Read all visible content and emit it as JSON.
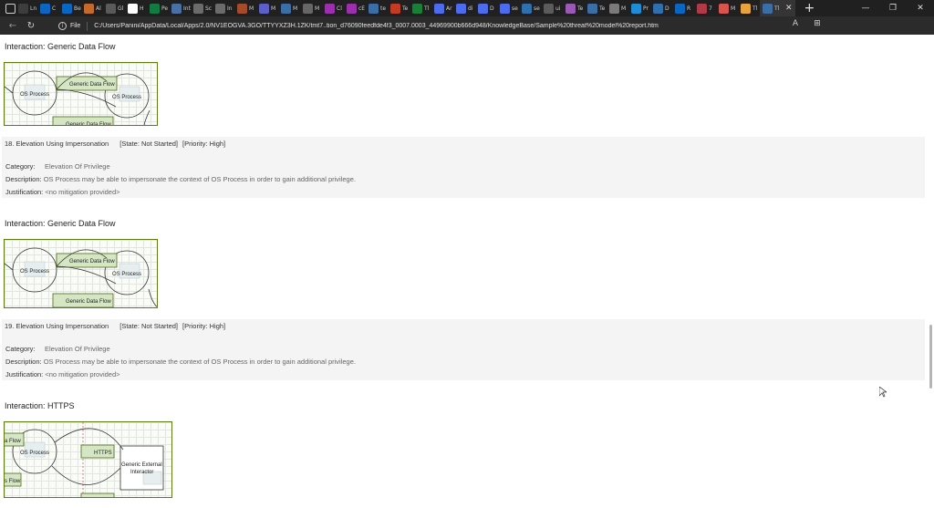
{
  "browser": {
    "tab_labels": [
      "Ln",
      "C",
      "Be",
      "Al",
      "Gl",
      "H",
      "Pe",
      "Int",
      "Sc",
      "In",
      "M",
      "M",
      "M",
      "M",
      "Cl",
      "cE",
      "te",
      "Te",
      "Tl",
      "Ar",
      "di",
      "D",
      "se",
      "se",
      "ui",
      "Te",
      "Te",
      "M",
      "Pr",
      "D",
      "R",
      "7",
      "M",
      "Tl"
    ],
    "active_tab_label": "Tl",
    "tab_colors": [
      "#3d3d3d",
      "#0a66c2",
      "#0a66c2",
      "#c56a2a",
      "#5a5a5a",
      "#ffffff",
      "#107c41",
      "#4a6fa5",
      "#6b6b6b",
      "#6b6b6b",
      "#a54a2a",
      "#5b5fc7",
      "#3b6ea5",
      "#666666",
      "#9b2fae",
      "#9b2fae",
      "#3b6ea5",
      "#c23b22",
      "#1a7f37",
      "#4f6bed",
      "#4f6bed",
      "#4f6bed",
      "#4f6bed",
      "#2f6fb0",
      "#5b5b5b",
      "#9b59b6",
      "#3b6ea5",
      "#7a7a7a",
      "#1f8dd6",
      "#2f6fb0",
      "#0a66c2",
      "#b23a48",
      "#d9534f",
      "#e8a33d"
    ],
    "file_label": "File",
    "url": "C:/Users/Panini/AppData/Local/Apps/2.0/NV1EOGVA.3GO/TTYYXZ3H.1ZK/tmt7..tion_d76090feedfde4f3_0007.0003_44969900b666d948/KnowledgeBase/Sample%20threat%20model%20report.htm",
    "window_controls": [
      "—",
      "❐",
      "✕"
    ]
  },
  "report": {
    "interaction1": "Interaction: Generic Data Flow",
    "interaction2": "Interaction: Generic Data Flow",
    "interaction3": "Interaction: HTTPS",
    "threat18": {
      "title": "18. Elevation Using Impersonation",
      "state": "[State: Not Started]",
      "priority": "[Priority: High]",
      "category_label": "Category:",
      "category": "Elevation Of Privilege",
      "description_label": "Description:",
      "description": "OS Process may be able to impersonate the context of OS Process in order to gain additional privilege.",
      "justification_label": "Justification:",
      "justification": "<no mitigation provided>"
    },
    "threat19": {
      "title": "19. Elevation Using Impersonation",
      "state": "[State: Not Started]",
      "priority": "[Priority: High]",
      "category_label": "Category:",
      "category": "Elevation Of Privilege",
      "description_label": "Description:",
      "description": "OS Process may be able to impersonate the context of OS Process in order to gain additional privilege.",
      "justification_label": "Justification:",
      "justification": "<no mitigation provided>"
    },
    "diagram_labels": {
      "os_process": "OS Process",
      "generic_data_flow": "Generic Data Flow",
      "https": "HTTPS",
      "external_interactor_1": "Generic External",
      "external_interactor_2": "Interactor",
      "a_flow": "a Flow",
      "s_flow": "s Flow"
    }
  }
}
